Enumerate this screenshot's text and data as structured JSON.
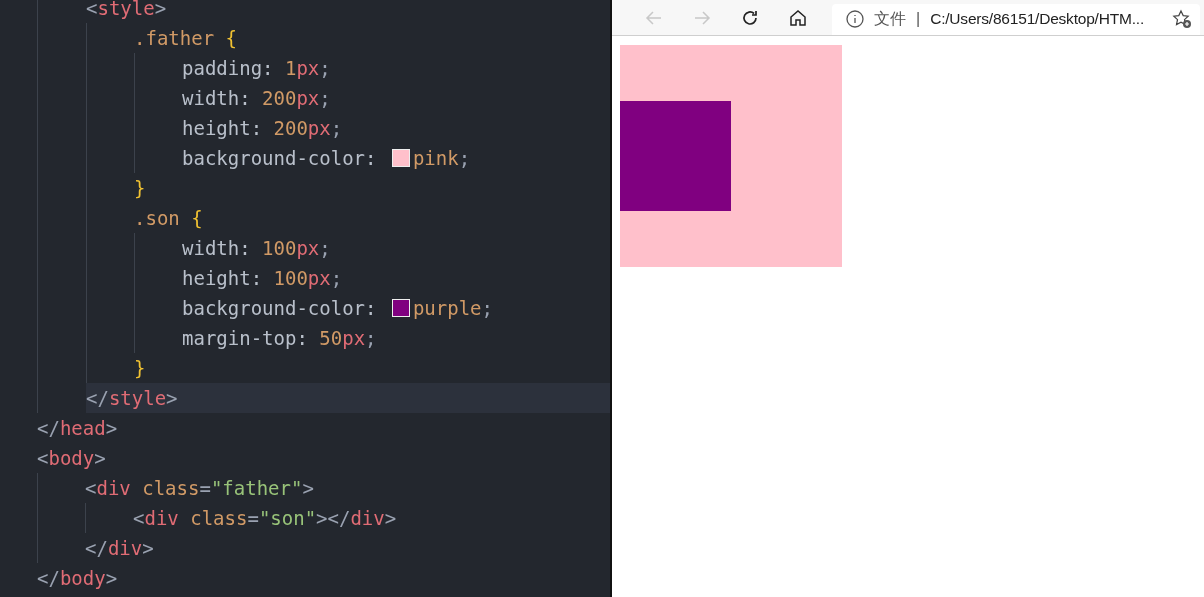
{
  "editor": {
    "head_children": [
      {
        "current": false,
        "tokens": [
          {
            "kind": "punct",
            "text": "<"
          },
          {
            "kind": "tag",
            "text": "style"
          },
          {
            "kind": "punct",
            "text": ">"
          }
        ],
        "children": [
          {
            "current": false,
            "tokens": [
              {
                "kind": "selector",
                "text": ".father"
              },
              {
                "kind": "brace",
                "text": "{"
              }
            ],
            "children": [
              {
                "current": false,
                "tokens": [
                  {
                    "kind": "prop",
                    "text": "padding:"
                  },
                  {
                    "kind": "num",
                    "text": "1"
                  },
                  {
                    "kind": "unit",
                    "text": "px"
                  },
                  {
                    "kind": "punct",
                    "text": ";"
                  }
                ]
              },
              {
                "current": false,
                "tokens": [
                  {
                    "kind": "prop",
                    "text": "width:"
                  },
                  {
                    "kind": "num",
                    "text": "200"
                  },
                  {
                    "kind": "unit",
                    "text": "px"
                  },
                  {
                    "kind": "punct",
                    "text": ";"
                  }
                ]
              },
              {
                "current": false,
                "tokens": [
                  {
                    "kind": "prop",
                    "text": "height:"
                  },
                  {
                    "kind": "num",
                    "text": "200"
                  },
                  {
                    "kind": "unit",
                    "text": "px"
                  },
                  {
                    "kind": "punct",
                    "text": ";"
                  }
                ]
              },
              {
                "current": false,
                "tokens": [
                  {
                    "kind": "prop",
                    "text": "background-color:"
                  },
                  {
                    "kind": "swatch",
                    "color": "#ffc0cb"
                  },
                  {
                    "kind": "value",
                    "text": "pink"
                  },
                  {
                    "kind": "punct",
                    "text": ";"
                  }
                ]
              }
            ]
          },
          {
            "current": false,
            "tokens": [
              {
                "kind": "brace",
                "text": "}"
              }
            ]
          },
          {
            "current": false,
            "tokens": [
              {
                "kind": "selector",
                "text": ".son"
              },
              {
                "kind": "brace",
                "text": "{"
              }
            ],
            "children": [
              {
                "current": false,
                "tokens": [
                  {
                    "kind": "prop",
                    "text": "width:"
                  },
                  {
                    "kind": "num",
                    "text": "100"
                  },
                  {
                    "kind": "unit",
                    "text": "px"
                  },
                  {
                    "kind": "punct",
                    "text": ";"
                  }
                ]
              },
              {
                "current": false,
                "tokens": [
                  {
                    "kind": "prop",
                    "text": "height:"
                  },
                  {
                    "kind": "num",
                    "text": "100"
                  },
                  {
                    "kind": "unit",
                    "text": "px"
                  },
                  {
                    "kind": "punct",
                    "text": ";"
                  }
                ]
              },
              {
                "current": false,
                "tokens": [
                  {
                    "kind": "prop",
                    "text": "background-color:"
                  },
                  {
                    "kind": "swatch",
                    "color": "#800080"
                  },
                  {
                    "kind": "value",
                    "text": "purple"
                  },
                  {
                    "kind": "punct",
                    "text": ";"
                  }
                ]
              },
              {
                "current": false,
                "tokens": [
                  {
                    "kind": "prop",
                    "text": "margin-top:"
                  },
                  {
                    "kind": "num",
                    "text": "50"
                  },
                  {
                    "kind": "unit",
                    "text": "px"
                  },
                  {
                    "kind": "punct",
                    "text": ";"
                  }
                ]
              }
            ]
          },
          {
            "current": false,
            "tokens": [
              {
                "kind": "brace",
                "text": "}"
              }
            ]
          }
        ]
      },
      {
        "current": true,
        "tokens": [
          {
            "kind": "punct",
            "text": "</"
          },
          {
            "kind": "tag",
            "text": "style"
          },
          {
            "kind": "punct",
            "text": ">"
          }
        ]
      }
    ],
    "lines": [
      {
        "current": false,
        "tokens": [
          {
            "kind": "punct",
            "text": "</"
          },
          {
            "kind": "tag",
            "text": "head"
          },
          {
            "kind": "punct",
            "text": ">"
          }
        ]
      },
      {
        "current": false,
        "tokens": [
          {
            "kind": "punct",
            "text": "<"
          },
          {
            "kind": "tag",
            "text": "body"
          },
          {
            "kind": "punct",
            "text": ">"
          }
        ],
        "children": [
          {
            "current": false,
            "tokens": [
              {
                "kind": "punct",
                "text": "<"
              },
              {
                "kind": "tag",
                "text": "div"
              },
              {
                "kind": "attr",
                "text": " class"
              },
              {
                "kind": "punct",
                "text": "="
              },
              {
                "kind": "str",
                "text": "\"father\""
              },
              {
                "kind": "punct",
                "text": ">"
              }
            ],
            "children": [
              {
                "current": false,
                "tokens": [
                  {
                    "kind": "punct",
                    "text": "<"
                  },
                  {
                    "kind": "tag",
                    "text": "div"
                  },
                  {
                    "kind": "attr",
                    "text": " class"
                  },
                  {
                    "kind": "punct",
                    "text": "="
                  },
                  {
                    "kind": "str",
                    "text": "\"son\""
                  },
                  {
                    "kind": "punct",
                    "text": "></"
                  },
                  {
                    "kind": "tag",
                    "text": "div"
                  },
                  {
                    "kind": "punct",
                    "text": ">"
                  }
                ]
              }
            ]
          },
          {
            "current": false,
            "tokens": [
              {
                "kind": "punct",
                "text": "</"
              },
              {
                "kind": "tag",
                "text": "div"
              },
              {
                "kind": "punct",
                "text": ">"
              }
            ]
          }
        ]
      },
      {
        "current": false,
        "tokens": [
          {
            "kind": "punct",
            "text": "</"
          },
          {
            "kind": "tag",
            "text": "body"
          },
          {
            "kind": "punct",
            "text": ">"
          }
        ]
      }
    ]
  },
  "browser": {
    "back_disabled": true,
    "forward_disabled": true,
    "address": {
      "scheme_label": "文件",
      "separator": "|",
      "url": "C:/Users/86151/Desktop/HTM..."
    }
  }
}
